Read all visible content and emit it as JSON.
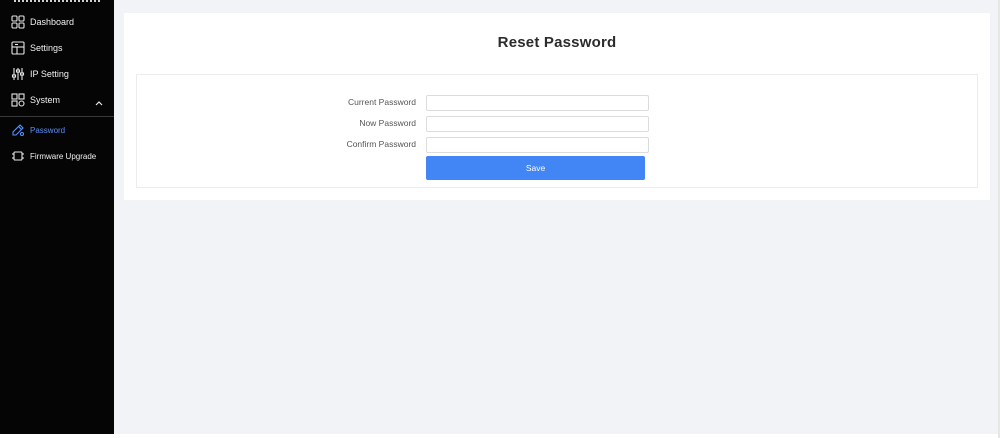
{
  "sidebar": {
    "items": [
      {
        "label": "Dashboard",
        "icon": "dashboard-grid-icon"
      },
      {
        "label": "Settings",
        "icon": "settings-panel-icon"
      },
      {
        "label": "IP Setting",
        "icon": "sliders-icon"
      },
      {
        "label": "System",
        "icon": "system-icon",
        "expanded": true
      }
    ],
    "sub_items": [
      {
        "label": "Password",
        "icon": "password-edit-icon",
        "active": true
      },
      {
        "label": "Firmware Upgrade",
        "icon": "chip-icon"
      }
    ]
  },
  "main": {
    "title": "Reset Password",
    "form": {
      "fields": [
        {
          "label": "Current Password",
          "value": "",
          "placeholder": ""
        },
        {
          "label": "Now Password",
          "value": "",
          "placeholder": ""
        },
        {
          "label": "Confirm Password",
          "value": "",
          "placeholder": ""
        }
      ],
      "save_label": "Save"
    }
  },
  "colors": {
    "sidebar_bg": "#050505",
    "active_accent": "#5b8ff9",
    "button_primary": "#4285f4",
    "page_bg": "#f2f3f7"
  }
}
